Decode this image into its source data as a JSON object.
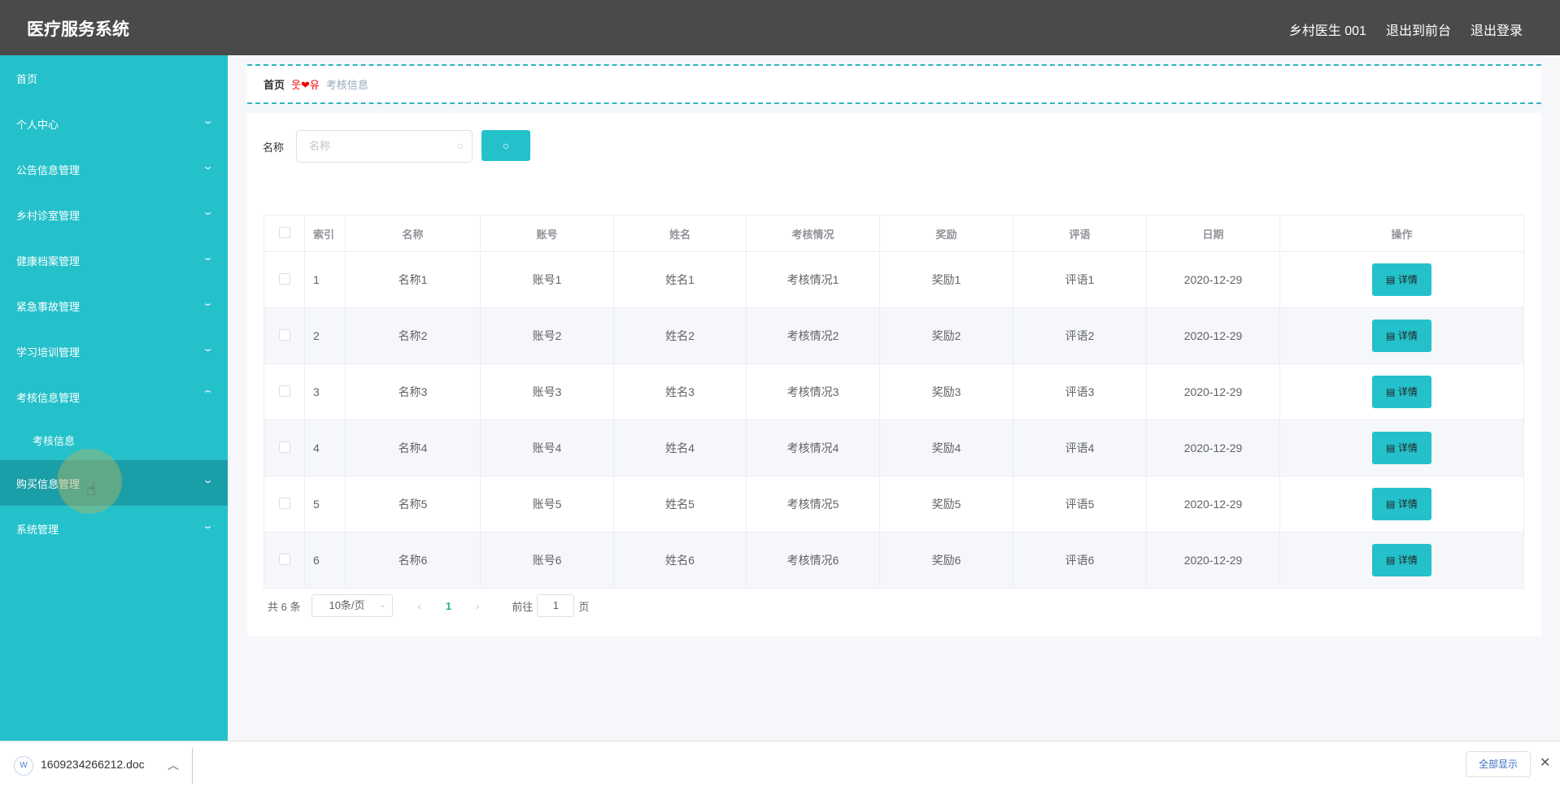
{
  "header": {
    "title": "医疗服务系统",
    "user": "乡村医生 001",
    "to_front": "退出到前台",
    "logout": "退出登录"
  },
  "sidebar": {
    "items": [
      {
        "label": "首页",
        "chevron": ""
      },
      {
        "label": "个人中心",
        "chevron": "⌄"
      },
      {
        "label": "公告信息管理",
        "chevron": "⌄"
      },
      {
        "label": "乡村诊室管理",
        "chevron": "⌄"
      },
      {
        "label": "健康档案管理",
        "chevron": "⌄"
      },
      {
        "label": "紧急事故管理",
        "chevron": "⌄"
      },
      {
        "label": "学习培训管理",
        "chevron": "⌄"
      },
      {
        "label": "考核信息管理",
        "chevron": "⌃"
      },
      {
        "label": "考核信息",
        "chevron": ""
      },
      {
        "label": "购买信息管理",
        "chevron": "⌄"
      },
      {
        "label": "系统管理",
        "chevron": "⌄"
      }
    ]
  },
  "breadcrumb": {
    "home": "首页",
    "separator": "웃❤유",
    "current": "考核信息"
  },
  "search": {
    "label": "名称",
    "placeholder": "名称"
  },
  "table": {
    "headers": [
      "索引",
      "名称",
      "账号",
      "姓名",
      "考核情况",
      "奖励",
      "评语",
      "日期",
      "操作"
    ],
    "rows": [
      [
        "1",
        "名称1",
        "账号1",
        "姓名1",
        "考核情况1",
        "奖励1",
        "评语1",
        "2020-12-29"
      ],
      [
        "2",
        "名称2",
        "账号2",
        "姓名2",
        "考核情况2",
        "奖励2",
        "评语2",
        "2020-12-29"
      ],
      [
        "3",
        "名称3",
        "账号3",
        "姓名3",
        "考核情况3",
        "奖励3",
        "评语3",
        "2020-12-29"
      ],
      [
        "4",
        "名称4",
        "账号4",
        "姓名4",
        "考核情况4",
        "奖励4",
        "评语4",
        "2020-12-29"
      ],
      [
        "5",
        "名称5",
        "账号5",
        "姓名5",
        "考核情况5",
        "奖励5",
        "评语5",
        "2020-12-29"
      ],
      [
        "6",
        "名称6",
        "账号6",
        "姓名6",
        "考核情况6",
        "奖励6",
        "评语6",
        "2020-12-29"
      ]
    ],
    "action_label": "详情"
  },
  "pagination": {
    "total": "共 6 条",
    "page_size": "10条/页",
    "current_page": "1",
    "goto_label": "前往",
    "goto_value": "1",
    "page_suffix": "页"
  },
  "download_bar": {
    "file": "1609234266212.doc",
    "show_all": "全部显示"
  },
  "colors": {
    "header": "#4a4a4a",
    "sidebar": "#24c1cb",
    "accent": "#24c1cb"
  }
}
